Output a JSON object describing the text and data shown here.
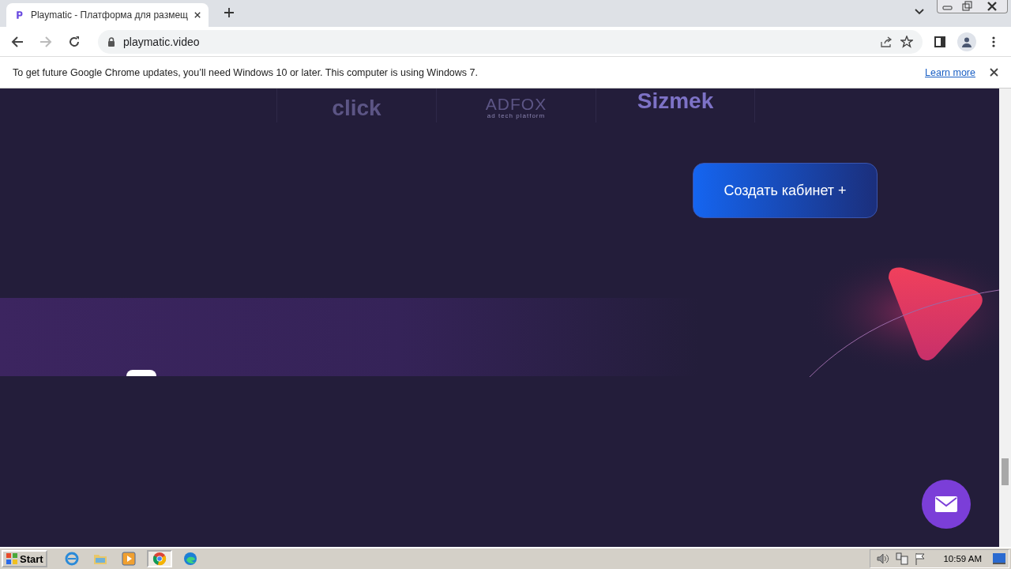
{
  "browser": {
    "tab": {
      "title": "Playmatic - Платформа для размещ",
      "selected": true
    },
    "address": "playmatic.video",
    "infobar": {
      "message": "To get future Google Chrome updates, you’ll need Windows 10 or later. This computer is using Windows 7.",
      "link": "Learn more"
    }
  },
  "page": {
    "partner_logos": [
      {
        "text": "click"
      },
      {
        "text": "ADFOX",
        "subtitle": "ad tech platform"
      },
      {
        "text": "Sizmek"
      }
    ],
    "cta_button": "Создать кабинет +"
  },
  "taskbar": {
    "start": "Start",
    "apps": [
      {
        "kind": "ie",
        "selected": false
      },
      {
        "kind": "folder",
        "selected": false
      },
      {
        "kind": "media",
        "selected": false
      },
      {
        "kind": "chrome",
        "selected": true
      },
      {
        "kind": "edge",
        "selected": false
      }
    ],
    "clock": "10:59 AM"
  }
}
